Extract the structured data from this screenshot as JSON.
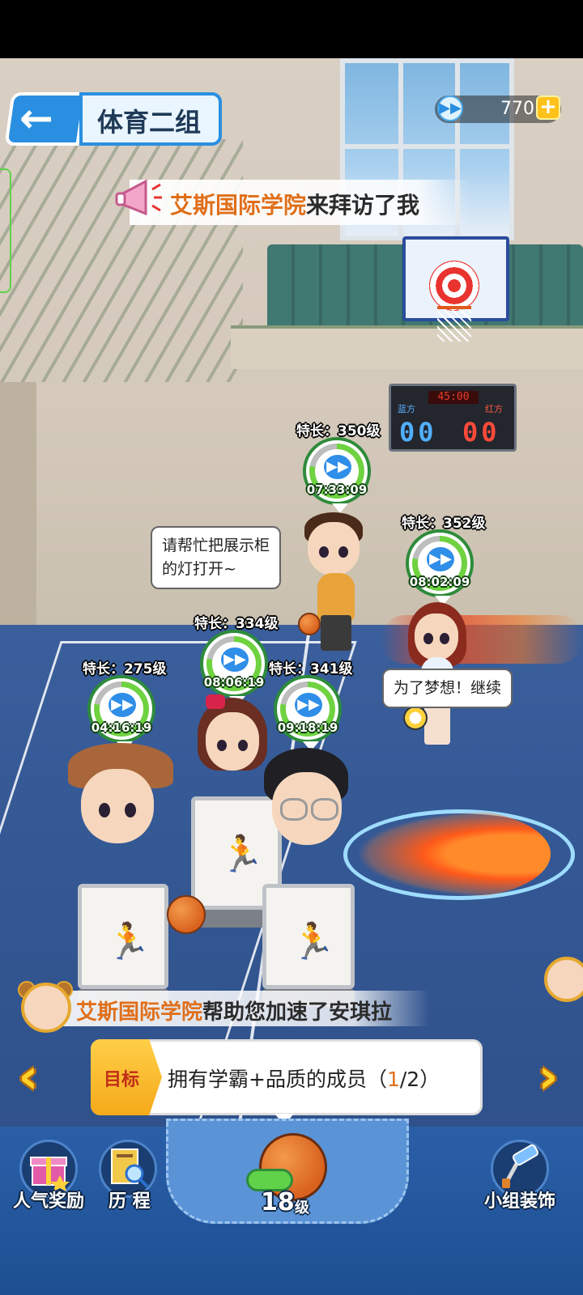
{
  "header": {
    "title": "体育二组",
    "coins": "770"
  },
  "announcement": {
    "school": "艾斯国际学院",
    "rest": "来拜访了我"
  },
  "scoreboard": {
    "time": "45:00",
    "blue_label": "蓝方",
    "red_label": "红方",
    "blue_score": "00",
    "red_score": "00"
  },
  "characters": [
    {
      "level": "特长：350级",
      "timer": "07:33:09",
      "progress": 0.78,
      "speech": [
        "请帮忙把展示柜",
        "的灯打开~"
      ]
    },
    {
      "level": "特长：352级",
      "timer": "08:02:09",
      "progress": 0.78,
      "speech": [
        "为了梦想！继续"
      ]
    },
    {
      "level": "特长：334级",
      "timer": "08:06:19",
      "progress": 0.78
    },
    {
      "level": "特长：275级",
      "timer": "04:16:19",
      "progress": 0.78
    },
    {
      "level": "特长：341级",
      "timer": "09:18:19",
      "progress": 0.78
    }
  ],
  "notice": {
    "school": "艾斯国际学院",
    "rest": "帮助您加速了安琪拉"
  },
  "goal": {
    "tag": "目标",
    "text_prefix": "拥有学霸+品质的成员（",
    "current": "1",
    "text_suffix": "/2）"
  },
  "bottom_nav": {
    "reward": "人气奖励",
    "history": "历 程",
    "level_num": "18",
    "level_unit": "级",
    "decor": "小组装饰"
  },
  "colors": {
    "accent_blue": "#2a8fe0",
    "highlight_orange": "#e06f1a",
    "progress_green": "#6fd241"
  },
  "icons": [
    "back-arrow-icon",
    "coin-icon",
    "plus-icon",
    "megaphone-icon",
    "fast-forward-icon",
    "gift-icon",
    "book-icon",
    "whistle-icon",
    "paint-roller-icon",
    "chevron-left-icon",
    "chevron-right-icon"
  ]
}
